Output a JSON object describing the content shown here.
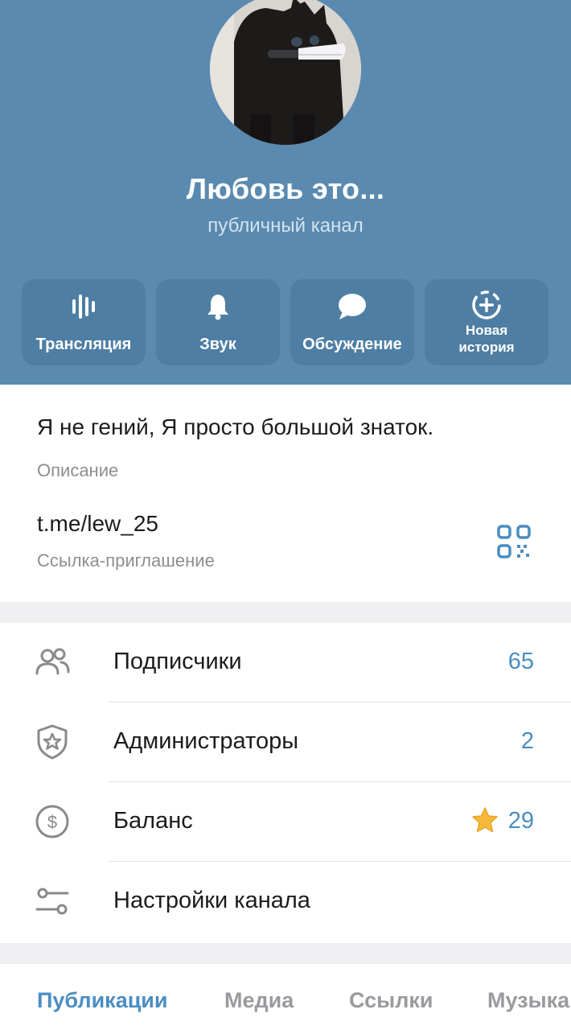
{
  "channel": {
    "title": "Любовь это...",
    "subtitle": "публичный канал"
  },
  "actions": [
    {
      "label": "Трансляция",
      "icon": "stream-icon"
    },
    {
      "label": "Звук",
      "icon": "bell-icon"
    },
    {
      "label": "Обсуждение",
      "icon": "chat-bubble-icon"
    },
    {
      "label_line1": "Новая",
      "label_line2": "история",
      "icon": "add-story-icon"
    }
  ],
  "info": {
    "description": "Я не гений, Я просто большой знаток.",
    "description_label": "Описание",
    "link": "t.me/lew_25",
    "link_label": "Ссылка-приглашение"
  },
  "menu": [
    {
      "label": "Подписчики",
      "value": "65",
      "icon": "subscribers-icon"
    },
    {
      "label": "Администраторы",
      "value": "2",
      "icon": "admin-shield-icon"
    },
    {
      "label": "Баланс",
      "value": "29",
      "icon": "dollar-coin-icon"
    },
    {
      "label": "Настройки канала",
      "value": "",
      "icon": "settings-sliders-icon"
    }
  ],
  "tabs": [
    {
      "label": "Публикации",
      "active": true
    },
    {
      "label": "Медиа",
      "active": false
    },
    {
      "label": "Ссылки",
      "active": false
    },
    {
      "label": "Музыка",
      "active": false
    }
  ],
  "colors": {
    "header": "#5a8ab0",
    "action_button": "#4e7ea3",
    "accent": "#4a8ec2",
    "star": "#f6b93b"
  }
}
